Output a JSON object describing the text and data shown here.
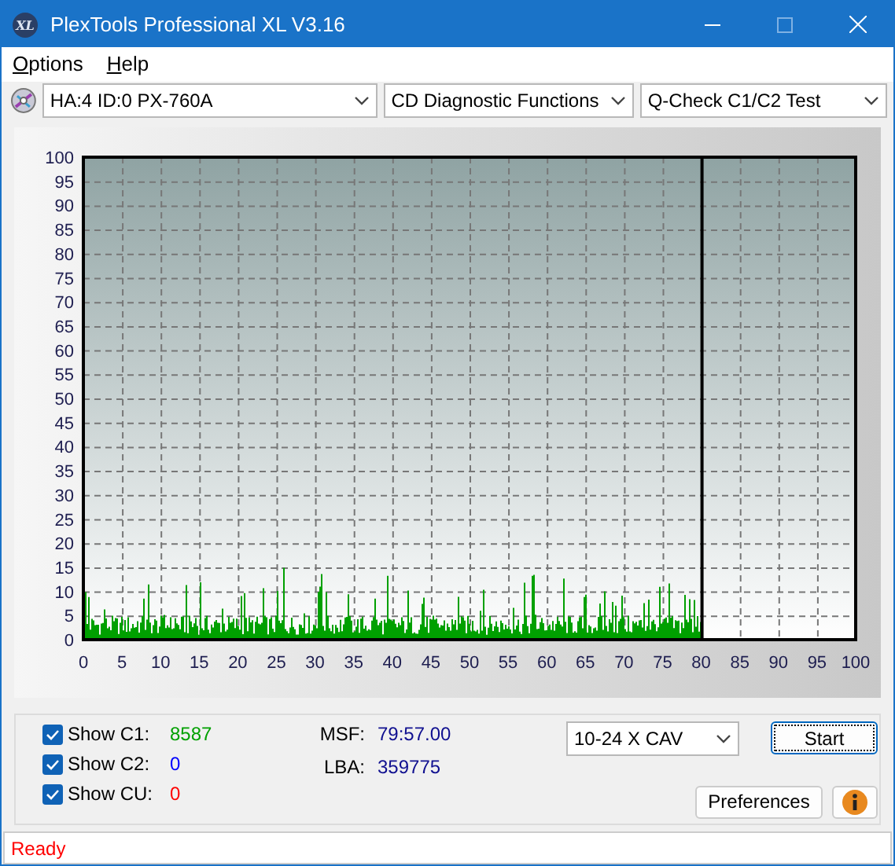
{
  "window": {
    "title": "PlexTools Professional XL V3.16",
    "logo": "XL"
  },
  "menu": [
    {
      "label": "Options"
    },
    {
      "label": "Help"
    }
  ],
  "toolbar": {
    "drive": "HA:4 ID:0  PX-760A",
    "function": "CD Diagnostic Functions",
    "test": "Q-Check C1/C2 Test"
  },
  "chart": {
    "yticks": [
      "100",
      "95",
      "90",
      "85",
      "80",
      "75",
      "70",
      "65",
      "60",
      "55",
      "50",
      "45",
      "40",
      "35",
      "30",
      "25",
      "20",
      "15",
      "10",
      "5",
      "0"
    ],
    "xticks": [
      "0",
      "5",
      "10",
      "15",
      "20",
      "25",
      "30",
      "35",
      "40",
      "45",
      "50",
      "55",
      "60",
      "65",
      "70",
      "75",
      "80",
      "85",
      "90",
      "95",
      "100"
    ]
  },
  "counters": [
    {
      "label": "Show C1:",
      "checked": true,
      "value": "8587",
      "color": "#00a000"
    },
    {
      "label": "Show C2:",
      "checked": true,
      "value": "0",
      "color": "#0000ff"
    },
    {
      "label": "Show CU:",
      "checked": true,
      "value": "0",
      "color": "#ff0000"
    }
  ],
  "readings": [
    {
      "label": "MSF:",
      "value": "79:57.00"
    },
    {
      "label": "LBA:",
      "value": "359775"
    }
  ],
  "speed": "10-24 X CAV",
  "buttons": {
    "start": "Start",
    "preferences": "Preferences"
  },
  "status": "Ready"
}
